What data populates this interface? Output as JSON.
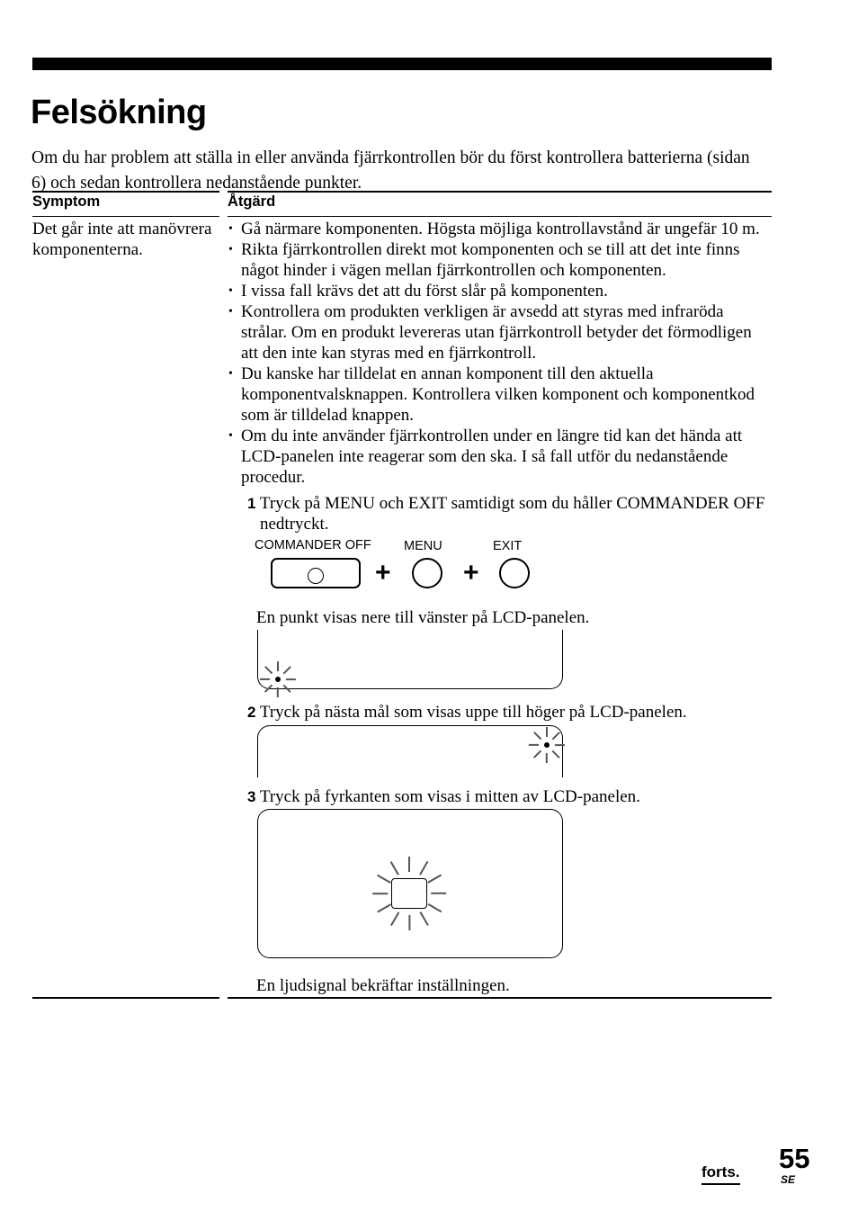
{
  "document": {
    "title": "Felsökning",
    "intro": "Om du har problem att ställa in eller använda fjärrkontrollen bör du först kontrollera batterierna (sidan 6) och sedan kontrollera nedanstående punkter."
  },
  "table": {
    "headers": {
      "symptom": "Symptom",
      "action": "Åtgärd"
    },
    "symptom_text": "Det går inte att manövrera komponenterna.",
    "bullets": [
      "Gå närmare komponenten. Högsta möjliga kontrollavstånd är ungefär 10 m.",
      "Rikta fjärrkontrollen direkt mot komponenten och se till att det inte finns något hinder i vägen mellan fjärrkontrollen och komponenten.",
      "I vissa fall krävs det att du först slår på komponenten.",
      "Kontrollera om produkten verkligen är avsedd att styras med infraröda strålar. Om en produkt levereras utan fjärrkontroll betyder det förmodligen att den inte kan styras med en fjärrkontroll.",
      "Du kanske har tilldelat en annan komponent till den aktuella komponentvalsknappen. Kontrollera vilken komponent och komponentkod som är tilldelad knappen.",
      "Om du inte använder fjärrkontrollen under en längre tid kan det hända att LCD-panelen inte reagerar som den ska. I så fall utför du nedanstående procedur."
    ]
  },
  "steps": [
    {
      "number": "1",
      "text": "Tryck på MENU och EXIT samtidigt som du håller COMMANDER OFF nedtryckt."
    },
    {
      "number": "2",
      "text": "Tryck på nästa mål som visas uppe till höger på LCD-panelen."
    },
    {
      "number": "3",
      "text": "Tryck på fyrkanten som visas i mitten av LCD-panelen."
    }
  ],
  "button_diagram": {
    "commander_off_label": "COMMANDER OFF",
    "menu_label": "MENU",
    "exit_label": "EXIT",
    "plus_1": "+",
    "plus_2": "+"
  },
  "captions": {
    "after_step_1": "En punkt visas nere till vänster på LCD-panelen.",
    "after_step_3": "En ljudsignal bekräftar inställningen."
  },
  "footer": {
    "continued": "forts.",
    "page_number": "55",
    "language_code": "SE"
  },
  "colors": {
    "ink": "#000000",
    "paper": "#ffffff",
    "ray": "#555555"
  }
}
